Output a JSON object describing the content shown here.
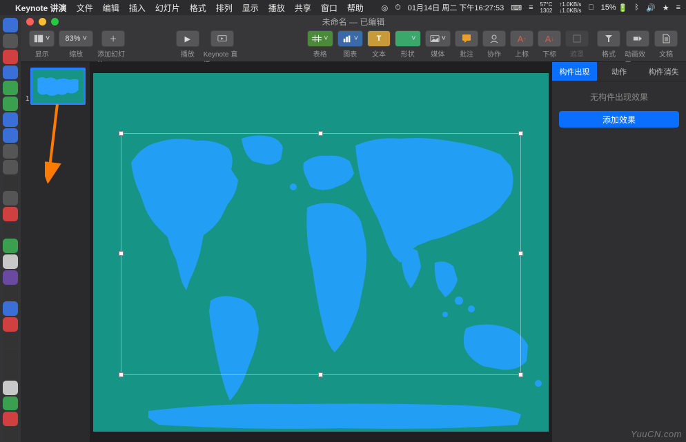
{
  "menubar": {
    "app_name": "Keynote 讲演",
    "menus": [
      "文件",
      "编辑",
      "插入",
      "幻灯片",
      "格式",
      "排列",
      "显示",
      "播放",
      "共享",
      "窗口",
      "帮助"
    ],
    "clock": "01月14日 周二 下午16:27:53",
    "temp": "57°C",
    "net_up": "1.0KB/s",
    "net_down": "1.0KB/s",
    "rpm": "1302",
    "battery": "15%"
  },
  "window": {
    "title": "未命名 — 已编辑"
  },
  "toolbar": {
    "view": "显示",
    "zoom_value": "83%",
    "zoom": "缩放",
    "add_slide": "添加幻灯片",
    "play": "播放",
    "keynote_live": "Keynote 直播",
    "table": "表格",
    "chart": "图表",
    "text": "文本",
    "shape": "形状",
    "media": "媒体",
    "comment": "批注",
    "collab": "协作",
    "upper": "上标",
    "lower": "下标",
    "mask": "遮罩",
    "format": "格式",
    "animate": "动画效果",
    "document": "文稿"
  },
  "thumbs": {
    "slide1_num": "1"
  },
  "inspector": {
    "tab_build_in": "构件出现",
    "tab_action": "动作",
    "tab_build_out": "构件消失",
    "no_effect": "无构件出现效果",
    "add_effect": "添加效果"
  },
  "watermark": "YuuCN.com"
}
